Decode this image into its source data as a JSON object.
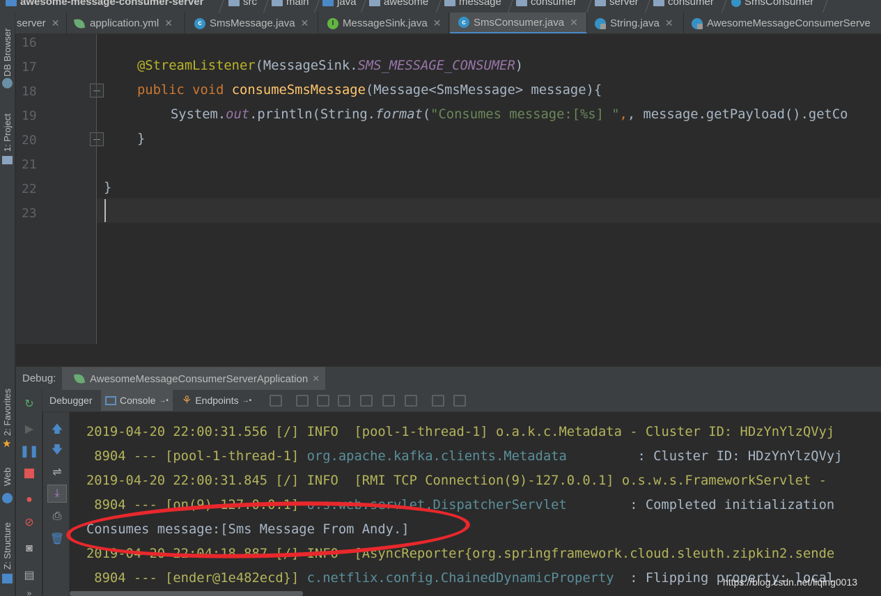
{
  "breadcrumb": {
    "project": "awesome-message-consumer-server",
    "items": [
      "src",
      "main",
      "java",
      "awesome",
      "message",
      "consumer",
      "server",
      "consumer",
      "SmsConsumer"
    ]
  },
  "tabs": [
    {
      "label": "server",
      "icon": "spring-icon"
    },
    {
      "label": "application.yml",
      "icon": "spring-leaf-icon"
    },
    {
      "label": "SmsMessage.java",
      "icon": "class-icon"
    },
    {
      "label": "MessageSink.java",
      "icon": "interface-icon"
    },
    {
      "label": "SmsConsumer.java",
      "icon": "class-icon",
      "active": true
    },
    {
      "label": "String.java",
      "icon": "locked-class-icon"
    },
    {
      "label": "AwesomeMessageConsumerServe",
      "icon": "spring-class-icon"
    }
  ],
  "left_toolbar": {
    "db_browser": "DB Browser",
    "project": "1: Project",
    "favorites": "2: Favorites",
    "web": "Web",
    "structure": "Z: Structure"
  },
  "editor": {
    "line_numbers": [
      "16",
      "17",
      "18",
      "19",
      "20",
      "21",
      "22",
      "23"
    ],
    "lines": {
      "l17_annotation": "@StreamListener",
      "l17_paren_open": "(MessageSink.",
      "l17_const": "SMS_MESSAGE_CONSUMER",
      "l17_paren_close": ")",
      "l18_kw1": "public",
      "l18_kw2": "void",
      "l18_method": "consumeSmsMessage",
      "l18_rest": "(Message<SmsMessage> message){",
      "l19_sys": "System.",
      "l19_out": "out",
      "l19_println": ".println(String.",
      "l19_format": "format",
      "l19_paren": "(",
      "l19_str": "\"Consumes message:[%s] \"",
      "l19_rest": ", message.getPayload().getCo",
      "l20": "}",
      "l22": "}"
    }
  },
  "debug": {
    "label": "Debug:",
    "session": "AwesomeMessageConsumerServerApplication",
    "tools": {
      "debugger": "Debugger",
      "console": "Console",
      "endpoints": "Endpoints"
    }
  },
  "console": {
    "lines": [
      {
        "ts": "2019-04-20 22:00:31.556",
        "rest": " [/] INFO  [pool-1-thread-1] o.a.k.c.Metadata - Cluster ID: HDzYnYlzQVyj"
      },
      {
        "prefix": " 8904 --- [pool-1-thread-1] ",
        "logger": "org.apache.kafka.clients.Metadata",
        "msg": "         : Cluster ID: HDzYnYlzQVyj"
      },
      {
        "ts": "2019-04-20 22:00:31.845",
        "rest": " [/] INFO  [RMI TCP Connection(9)-127.0.0.1] o.s.w.s.FrameworkServlet - "
      },
      {
        "prefix": " 8904 --- [on(9)-127.0.0.1] ",
        "logger": "o.s.web.servlet.DispatcherServlet",
        "msg": "        : Completed initialization"
      },
      {
        "plain": "Consumes message:[Sms Message From Andy.]"
      },
      {
        "ts": "2019-04-20 22:04:18.887",
        "rest": " [/] INFO  [AsyncReporter{org.springframework.cloud.sleuth.zipkin2.sende"
      },
      {
        "prefix": " 8904 --- [ender@1e482ecd}] ",
        "logger": "c.netflix.config.ChainedDynamicProperty",
        "msg": "  : Flipping property: local"
      }
    ]
  },
  "watermark": "https://blog.csdn.net/liqing0013",
  "colors": {
    "keyword": "#cc7832",
    "annotation": "#bbb529",
    "method": "#ffc66d",
    "string": "#6a8759",
    "constant": "#9876aa",
    "console_text": "#b4b45c",
    "console_logger": "#5a8f9b",
    "highlight_oval": "#e8282c"
  }
}
